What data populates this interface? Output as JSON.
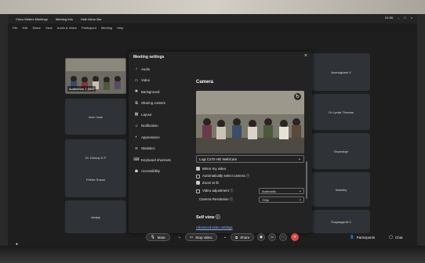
{
  "window": {
    "title": "Cisco Webex Meetings",
    "menu_title_items": [
      "Meeting Info",
      "Hide Menu Bar"
    ],
    "time": "01:55"
  },
  "menubar": [
    "File",
    "Edit",
    "Share",
    "View",
    "Audio & Video",
    "Participant",
    "Meeting",
    "Help"
  ],
  "self_view": {
    "label": "Auditorium 2 (Me)"
  },
  "left_tiles": [
    "Arun Jose",
    "Dr. Dinoop K P",
    "Phebe Susan",
    "sanjay"
  ],
  "right_tiles": [
    "Arumugham V",
    "Dr Lynda Thomas",
    "Seymdrge",
    "Sabeley",
    "Thapaaga.M.C"
  ],
  "dialog": {
    "title": "Meeting settings",
    "close": "×",
    "nav": [
      {
        "icon": "microphone-icon",
        "glyph": "♪",
        "label": "Audio"
      },
      {
        "icon": "video-icon",
        "glyph": "▭",
        "label": "Video"
      },
      {
        "icon": "background-icon",
        "glyph": "✱",
        "label": "Background"
      },
      {
        "icon": "share-icon",
        "glyph": "⧉",
        "label": "Sharing content"
      },
      {
        "icon": "layout-icon",
        "glyph": "▦",
        "label": "Layout"
      },
      {
        "icon": "bell-icon",
        "glyph": "♫",
        "label": "Notification"
      },
      {
        "icon": "palette-icon",
        "glyph": "◐",
        "label": "Appearance"
      },
      {
        "icon": "statistics-icon",
        "glyph": "≋",
        "label": "Statistics"
      },
      {
        "icon": "keyboard-icon",
        "glyph": "⌨",
        "label": "Keyboard shortcuts"
      },
      {
        "icon": "accessibility-icon",
        "glyph": "☗",
        "label": "Accessibility"
      }
    ],
    "camera": {
      "heading": "Camera",
      "device": "Logi C270 HD WebCam",
      "mirror": "Mirror my video",
      "auto_select": "Automatically select camera ⓘ",
      "zoom": "Zoom to fit",
      "video_adjust": "Video adjustment ⓘ",
      "video_adjust_value": "Automatic",
      "resolution_label": "Camera Resolution ⓘ",
      "resolution_value": "720p",
      "self_view": "Self view ⓘ",
      "advanced": "Advanced video settings"
    }
  },
  "controls": {
    "mute": "Mute",
    "stop_video": "Stop video",
    "share": "Share",
    "participants": "Participants",
    "chat": "Chat"
  }
}
